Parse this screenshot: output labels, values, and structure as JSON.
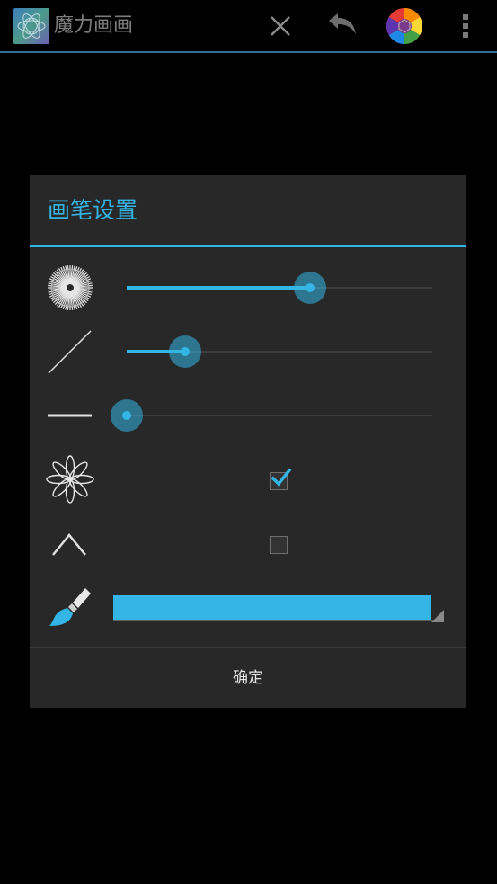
{
  "app": {
    "title": "魔力画画"
  },
  "actionbar": {
    "close_icon": "close-icon",
    "undo_icon": "undo-icon",
    "color_wheel_icon": "color-wheel-icon",
    "overflow_icon": "overflow-menu-icon"
  },
  "dialog": {
    "title": "画笔设置",
    "rows": [
      {
        "icon": "brush-size-icon",
        "control": "slider",
        "value_fraction": 0.6
      },
      {
        "icon": "line-opacity-icon",
        "control": "slider",
        "value_fraction": 0.19
      },
      {
        "icon": "line-width-icon",
        "control": "slider",
        "value_fraction": 0.0
      },
      {
        "icon": "flower-symmetry-icon",
        "control": "checkbox",
        "checked": true
      },
      {
        "icon": "chevron-up-icon",
        "control": "checkbox",
        "checked": false
      },
      {
        "icon": "paintbrush-icon",
        "control": "color",
        "color": "#33b5e5"
      }
    ],
    "confirm_label": "确定"
  },
  "colors": {
    "accent": "#33b5e5",
    "dialog_bg": "#282828",
    "background": "#000000"
  }
}
